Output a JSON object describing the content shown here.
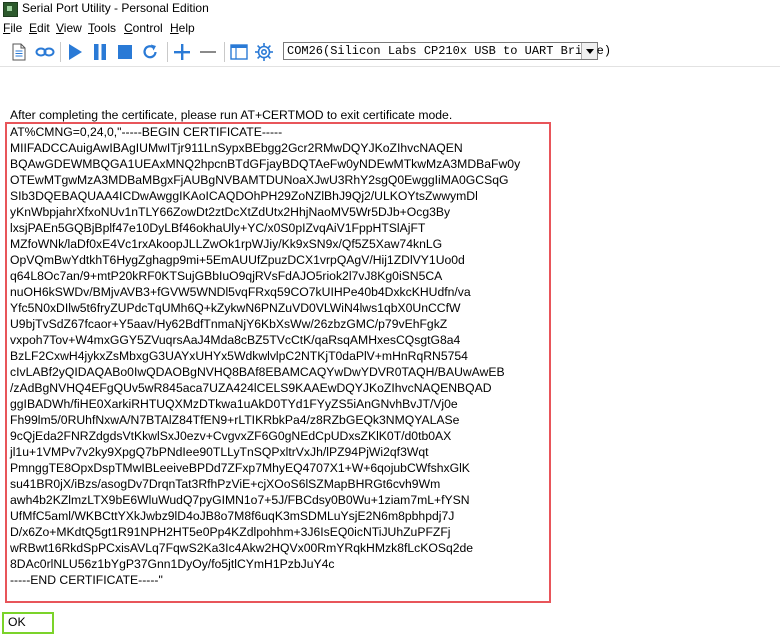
{
  "window": {
    "title": "Serial Port Utility - Personal Edition",
    "app_icon": "serial-port-utility-app-icon"
  },
  "menu": [
    "File",
    "Edit",
    "View",
    "Tools",
    "Control",
    "Help"
  ],
  "toolbar": {
    "buttons": [
      {
        "icon": "new-document-icon"
      },
      {
        "icon": "link-icon"
      },
      {
        "icon": "play-icon"
      },
      {
        "icon": "pause-icon"
      },
      {
        "icon": "stop-icon"
      },
      {
        "icon": "refresh-icon"
      },
      {
        "icon": "plus-icon"
      },
      {
        "icon": "minus-icon"
      },
      {
        "icon": "window-layout-icon"
      },
      {
        "icon": "gear-icon"
      }
    ],
    "port_value": "COM26(Silicon Labs CP210x USB to UART Bridge)",
    "accent_blue": "#2a7ad6"
  },
  "terminal": {
    "lines": [
      "After completing the certificate, please run AT+CERTMOD to exit certificate mode.",
      "AT%CMNG=0,24,0,\"-----BEGIN CERTIFICATE-----",
      "MIIFADCCAuigAwIBAgIUMwITjr911LnSypxBEbgg2Gcr2RMwDQYJKoZIhvcNAQEN",
      "BQAwGDEWMBQGA1UEAxMNQ2hpcnBTdGFjayBDQTAeFw0yNDEwMTkwMzA3MDBaFw0y",
      "OTEwMTgwMzA3MDBaMBgxFjAUBgNVBAMTDUNoaXJwU3RhY2sgQ0EwggIiMA0GCSqG",
      "SIb3DQEBAQUAA4ICDwAwggIKAoICAQDOhPH29ZoNZlBhJ9Qj2/ULKOYtsZwwymDl",
      "yKnWbpjahrXfxoNUv1nTLY66ZowDt2ztDcXtZdUtx2HhjNaoMV5Wr5DJb+Ocg3By",
      "lxsjPAEn5GQBjBplf47e10DyLBf46okhaUly+YC/x0S0pIZvqAiV1FppHTSlAjFT",
      "MZfoWNk/laDf0xE4Vc1rxAkoopJLLZwOk1rpWJiy/Kk9xSN9x/Qf5Z5Xaw74knLG",
      "OpVQmBwYdtkhT6HygZghagp9mi+5EmAUUfZpuzDCX1vrpQAgV/Hij1ZDlVY1Uo0d",
      "q64L8Oc7an/9+mtP20kRF0KTSujGBbIuO9qjRVsFdAJO5riok2l7vJ8Kg0iSN5CA",
      "nuOH6kSWDv/BMjvAVB3+fGVW5WNDl5vqFRxq59CO7kUIHPe40b4DxkcKHUdfn/va",
      "Yfc5N0xDIlw5t6fryZUPdcTqUMh6Q+kZykwN6PNZuVD0VLWiN4lws1qbX0UnCCfW",
      "U9bjTvSdZ67fcaor+Y5aav/Hy62BdfTnmaNjY6KbXsWw/26zbzGMC/p79vEhFgkZ",
      "vxpoh7Tov+W4mxGGY5ZVuqrsAaJ4Mda8cBZ5TVcCtK/qaRsqAMHxesCQsgtG8a4",
      "BzLF2CxwH4jykxZsMbxgG3UAYxUHYx5WdkwlvlpC2NTKjT0daPlV+mHnRqRN5754",
      "cIvLABf2yQIDAQABo0IwQDAOBgNVHQ8BAf8EBAMCAQYwDwYDVR0TAQH/BAUwAwEB",
      "/zAdBgNVHQ4EFgQUv5wR845aca7UZA424lCELS9KAAEwDQYJKoZIhvcNAQENBQAD",
      "ggIBADWh/fiHE0XarkiRHTUQXMzDTkwa1uAkD0TYd1FYyZS5iAnGNvhBvJT/Vj0e",
      "Fh99lm5/0RUhfNxwA/N7BTAlZ84TfEN9+rLTIKRbkPa4/z8RZbGEQk3NMQYALASe",
      "9cQjEda2FNRZdgdsVtKkwlSxJ0ezv+CvgvxZF6G0gNEdCpUDxsZKlK0T/d0tb0AX",
      "jl1u+1VMPv7v2ky9XpgQ7bPNdIee90TLLyTnSQPxltrVxJh/lPZ94PjWi2qf3Wqt",
      "PmnggTE8OpxDspTMwIBLeeiveBPDd7ZFxp7MhyEQ4707X1+W+6qojubCWfshxGlK",
      "su41BR0jX/iBzs/asogDv7DrqnTat3RfhPzViE+cjXOoS6lSZMapBHRGt6cvh9Wm",
      "awh4b2KZlmzLTX9bE6WluWudQ7pyGIMN1o7+5J/FBCdsy0B0Wu+1ziam7mL+fYSN",
      "UfMfC5aml/WKBCttYXkJwbz9lD4oJB8o7M8f6uqK3mSDMLuYsjE2N6m8pbhpdj7J",
      "D/x6Zo+MKdtQ5gt1R91NPH2HT5e0Pp4KZdlpohhm+3J6IsEQ0icNTiJUhZuPFZFj",
      "wRBwt16RkdSpPCxisAVLq7FqwS2Ka3Ic4Akw2HQVx00RmYRqkHMzk8fLcKOSq2de",
      "8DAc0rlNLU56z1bYgP37Gnn1DyOy/fo5jtlCYmH1PzbJuY4c",
      "-----END CERTIFICATE-----\""
    ],
    "response": "OK",
    "highlight_cert_color": "#e8555a",
    "highlight_ok_color": "#7bd32a"
  }
}
